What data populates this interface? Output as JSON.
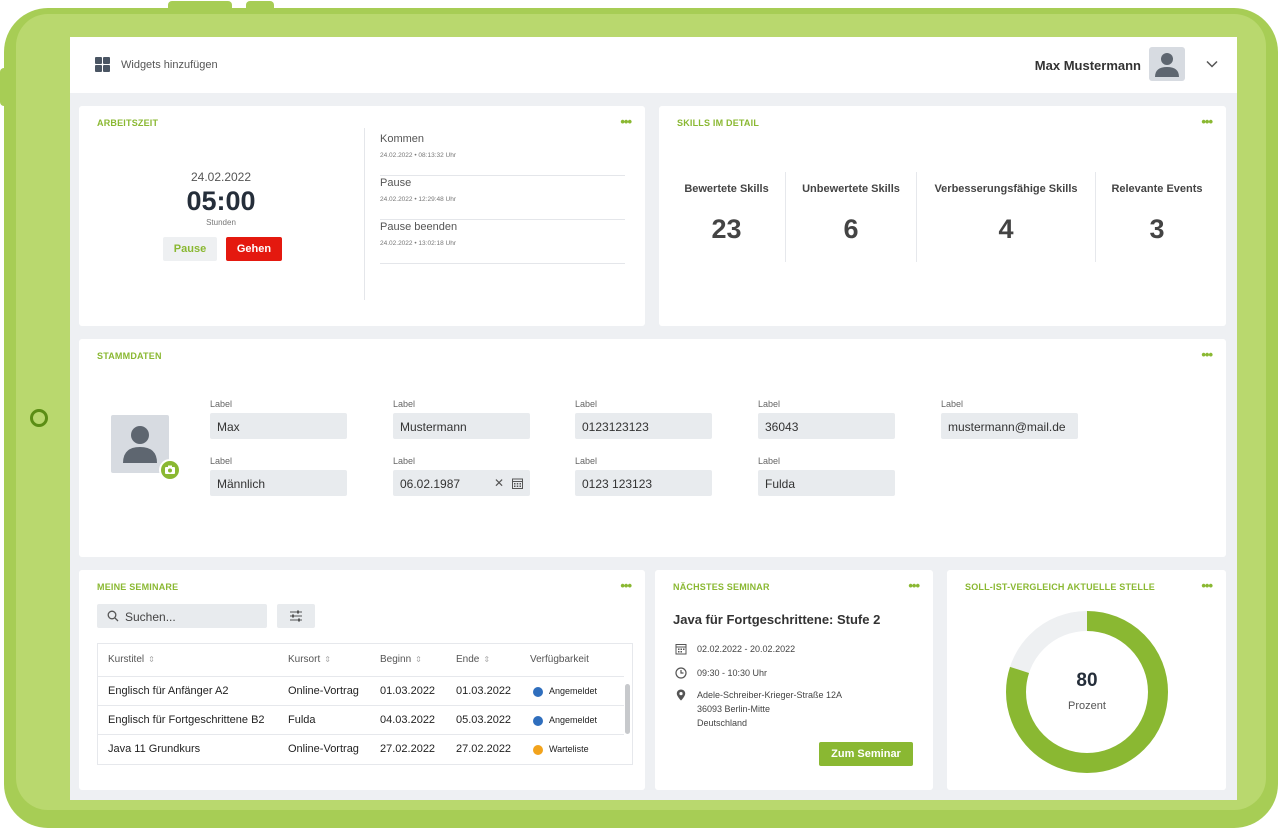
{
  "topbar": {
    "widgets_label": "Widgets hinzufügen",
    "user_name": "Max Mustermann"
  },
  "arbeitszeit": {
    "title": "ARBEITSZEIT",
    "more": "•••",
    "date": "24.02.2022",
    "time": "05:00",
    "unit": "Stunden",
    "pause_label": "Pause",
    "gehen_label": "Gehen",
    "log": [
      {
        "title": "Kommen",
        "meta": "24.02.2022 • 08:13:32 Uhr"
      },
      {
        "title": "Pause",
        "meta": "24.02.2022 • 12:29:48 Uhr"
      },
      {
        "title": "Pause beenden",
        "meta": "24.02.2022 • 13:02:18 Uhr"
      }
    ]
  },
  "skills": {
    "title": "SKILLS IM DETAIL",
    "more": "•••",
    "items": [
      {
        "label": "Bewertete Skills",
        "value": "23"
      },
      {
        "label": "Unbewertete Skills",
        "value": "6"
      },
      {
        "label": "Verbesserungsfähige Skills",
        "value": "4"
      },
      {
        "label": "Relevante Events",
        "value": "3"
      }
    ]
  },
  "stammdaten": {
    "title": "STAMMDATEN",
    "more": "•••",
    "fields": [
      {
        "label": "Label",
        "value": "Max"
      },
      {
        "label": "Label",
        "value": "Mustermann"
      },
      {
        "label": "Label",
        "value": "0123123123"
      },
      {
        "label": "Label",
        "value": "36043"
      },
      {
        "label": "Label",
        "value": "mustermann@mail.de"
      },
      {
        "label": "Label",
        "value": "Männlich"
      },
      {
        "label": "Label",
        "value": "06.02.1987"
      },
      {
        "label": "Label",
        "value": "0123 123123"
      },
      {
        "label": "Label",
        "value": "Fulda"
      }
    ]
  },
  "seminare": {
    "title": "MEINE SEMINARE",
    "more": "•••",
    "search_placeholder": "Suchen...",
    "columns": [
      "Kurstitel",
      "Kursort",
      "Beginn",
      "Ende",
      "Verfügbarkeit"
    ],
    "rows": [
      {
        "title": "Englisch für Anfänger A2",
        "ort": "Online-Vortrag",
        "beginn": "01.03.2022",
        "ende": "01.03.2022",
        "status": "Angemeldet",
        "status_color": "#2f6ebd"
      },
      {
        "title": "Englisch für Fortgeschrittene B2",
        "ort": "Fulda",
        "beginn": "04.03.2022",
        "ende": "05.03.2022",
        "status": "Angemeldet",
        "status_color": "#2f6ebd"
      },
      {
        "title": "Java 11 Grundkurs",
        "ort": "Online-Vortrag",
        "beginn": "27.02.2022",
        "ende": "27.02.2022",
        "status": "Warteliste",
        "status_color": "#f2a31c"
      }
    ]
  },
  "naechstes": {
    "title": "NÄCHSTES SEMINAR",
    "more": "•••",
    "name": "Java für Fortgeschrittene: Stufe 2",
    "date_range": "02.02.2022 - 20.02.2022",
    "time_range": "09:30 - 10:30 Uhr",
    "address_line1": "Adele-Schreiber-Krieger-Straße 12A",
    "address_line2": "36093 Berlin-Mitte",
    "address_line3": "Deutschland",
    "button_label": "Zum Seminar"
  },
  "sollist": {
    "title": "SOLL-IST-VERGLEICH AKTUELLE STELLE",
    "more": "•••",
    "value": "80",
    "percent": 80,
    "unit": "Prozent"
  },
  "colors": {
    "accent": "#8ab832",
    "danger": "#e4190f",
    "frame": "#a7cd55"
  }
}
